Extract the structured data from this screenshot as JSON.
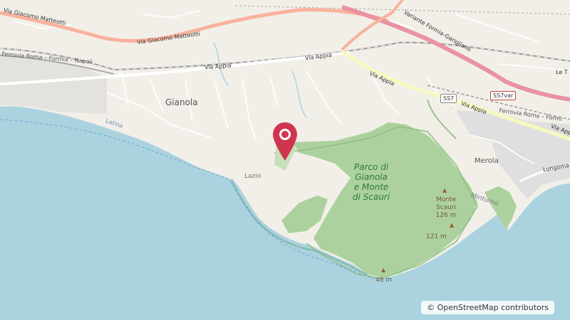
{
  "map": {
    "colors": {
      "sea": "#aad3df",
      "land": "#f2efe9",
      "park": "#add19e",
      "park_border": "#8bbf82",
      "motorway": "#e892a2",
      "trunk": "#f9b29c",
      "primary": "#fcd6a4",
      "secondary": "#f7fabf",
      "rail": "#999999",
      "marker": "#d0354f"
    },
    "labels": {
      "gianola": "Gianola",
      "latina": "Latina",
      "lazio": "Lazio",
      "park_line1": "Parco di",
      "park_line2": "Gianola",
      "park_line3": "e Monte",
      "park_line4": "di Scauri",
      "merola": "Merola",
      "minturno": "Minturno",
      "monte_scauri": "Monte",
      "monte_scauri_2": "Scauri",
      "elev_126": "126 m",
      "elev_121": "121 m",
      "elev_48": "48 m",
      "via_giacomo_matteotti_1": "Via Giacomo Matteotti",
      "via_giacomo_matteotti_2": "Via Giacomo Matteotti",
      "via_appia_1": "Via Appia",
      "via_appia_2": "Via Appia",
      "via_appia_3": "Via Appia",
      "via_appia_4": "Via Appia",
      "via_appia_5": "Via Appia",
      "ferrovia_napoli": "Ferrovia Roma – Formia – Napoli",
      "ferrovia_formia": "Ferrovia Roma – Formi",
      "variante": "Variante Formia-Garigliano",
      "lungomare": "Lungoma",
      "le_t": "Le T",
      "ss7": "SS7",
      "ss7var": "SS7var"
    },
    "attribution": "© OpenStreetMap contributors",
    "marker_icon": "map-pin-icon"
  }
}
